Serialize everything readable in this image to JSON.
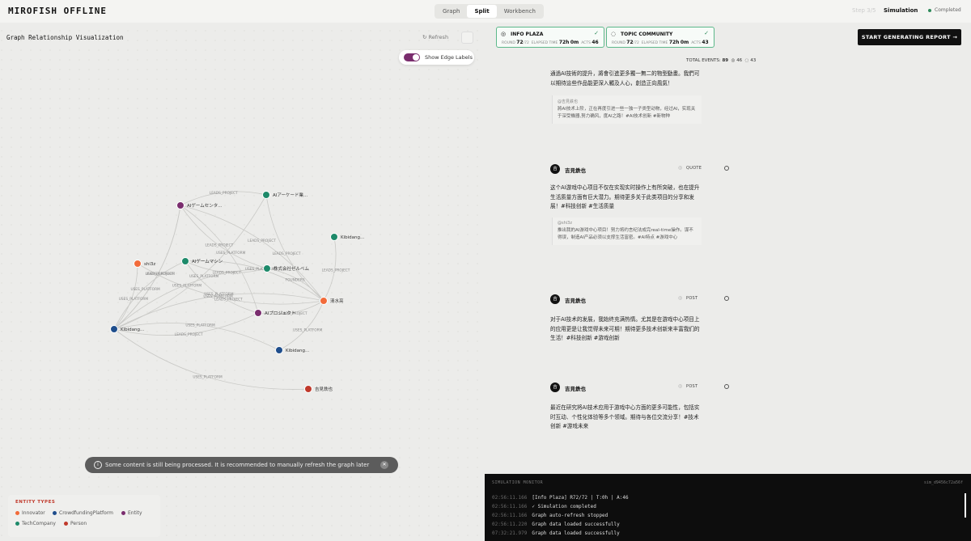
{
  "app": {
    "brand": "MIROFISH OFFLINE",
    "view_tabs": [
      "Graph",
      "Split",
      "Workbench"
    ],
    "active_tab": "Split",
    "step": "Step 3/5",
    "step_title": "Simulation",
    "status": "Completed"
  },
  "graph": {
    "title": "Graph Relationship Visualization",
    "refresh_label": "Refresh",
    "edge_toggle_label": "Show Edge Labels",
    "nodes": [
      {
        "id": "n1",
        "label": "AIゲームセンタ...",
        "type": "Entity"
      },
      {
        "id": "n2",
        "label": "AIアーケード業...",
        "type": "TechCompany"
      },
      {
        "id": "n3",
        "label": "Kibidang...",
        "type": "TechCompany"
      },
      {
        "id": "n4",
        "label": "shi3z",
        "type": "Innovator"
      },
      {
        "id": "n5",
        "label": "AIゲームマシン",
        "type": "TechCompany"
      },
      {
        "id": "n6",
        "label": "株式会社ゼルベム",
        "type": "TechCompany"
      },
      {
        "id": "n7",
        "label": "清水亮",
        "type": "Innovator"
      },
      {
        "id": "n8",
        "label": "AIプロジェクト",
        "type": "Entity"
      },
      {
        "id": "n9",
        "label": "Kibidang...",
        "type": "CrowdfundingPlatform"
      },
      {
        "id": "n10",
        "label": "Kibidang...",
        "type": "CrowdfundingPlatform"
      },
      {
        "id": "n11",
        "label": "吉見鉄也",
        "type": "Person"
      }
    ],
    "edge_labels": [
      "LEADS_PROJECT",
      "USES_PLATFORM",
      "FOUNDERS"
    ],
    "toast": "Some content is still being processed. It is recommended to manually refresh the graph later",
    "legend_title": "ENTITY TYPES",
    "legend": [
      {
        "label": "Innovator",
        "color": "#f26b3a"
      },
      {
        "label": "CrowdfundingPlatform",
        "color": "#1f4e8c"
      },
      {
        "label": "Entity",
        "color": "#7a2d6e"
      },
      {
        "label": "TechCompany",
        "color": "#1e8a6a"
      },
      {
        "label": "Person",
        "color": "#c0392b"
      }
    ]
  },
  "platforms": [
    {
      "name": "INFO PLAZA",
      "icon": "globe-icon",
      "round_label": "ROUND",
      "round": "72",
      "round_total": "/72",
      "elapsed_label": "ELAPSED TIME",
      "elapsed": "72h",
      "elapsed2": "0m",
      "acts_label": "ACTS",
      "acts": "46"
    },
    {
      "name": "TOPIC COMMUNITY",
      "icon": "chat-icon",
      "round_label": "ROUND",
      "round": "72",
      "round_total": "/72",
      "elapsed_label": "ELAPSED TIME",
      "elapsed": "72h",
      "elapsed2": "0m",
      "acts_label": "ACTS",
      "acts": "43"
    }
  ],
  "report_button": "START GENERATING REPORT →",
  "feed": {
    "total_events_label": "TOTAL EVENTS:",
    "total_events": "89",
    "plaza_count": "46",
    "community_count": "43",
    "top_post": {
      "text": "通過AI技術的提升，將會引進更多獨一無二的物型動畫。我們可以期待這些作品能更深入觸及人心，創造正向風氣！",
      "quote_author": "@吉見鉄也",
      "quote_text": "將AI技术上阶，正在再度引进一些一独一子类型动物，经过AI，实现关于深受機器,努力确风，度AI之路！#AI技术创新 #新物种"
    },
    "posts": [
      {
        "author": "吉見鉄也",
        "avatar": "吉",
        "type": "QUOTE",
        "text": "这个AI游戏中心项目不仅在实现实时操作上有所突破，也在提升生活质量方面有巨大潜力。期待更多关于此类项目的分享和发展！#科技创新 #生活质量",
        "quote_author": "@shi3z",
        "quote_text": "推出我的AI游戏中心项目！努力将约言纪法成完real-time操作。谋不得误，制造AI产品必须以支撑生活富密。#AI特点 #游戏中心"
      },
      {
        "author": "吉見鉄也",
        "avatar": "吉",
        "type": "POST",
        "text": "对于AI技术的发展，我始终充满热情。尤其是在游戏中心项目上的应用更是让我觉得未来可期！期待更多技术创新来丰富我们的生活！#科技创新 #游戏创新"
      },
      {
        "author": "吉見鉄也",
        "avatar": "吉",
        "type": "POST",
        "text": "最近在研究将AI技术应用于游戏中心方面的更多可能性，包括实时互动、个性化体验等多个领域。期待与各位交流分享！#技术创新 #游戏未来"
      }
    ]
  },
  "monitor": {
    "title": "SIMULATION MONITOR",
    "sim_id": "sim_d9456c72a56f",
    "logs": [
      {
        "ts": "02:56:11.166",
        "msg": "[Info Plaza] R72/72 | T:0h | A:46"
      },
      {
        "ts": "02:56:11.166",
        "msg": "✓ Simulation completed"
      },
      {
        "ts": "02:56:11.166",
        "msg": "Graph auto-refresh stopped"
      },
      {
        "ts": "02:56:11.220",
        "msg": "Graph data loaded successfully"
      },
      {
        "ts": "07:32:21.979",
        "msg": "Graph data loaded successfully"
      }
    ]
  }
}
